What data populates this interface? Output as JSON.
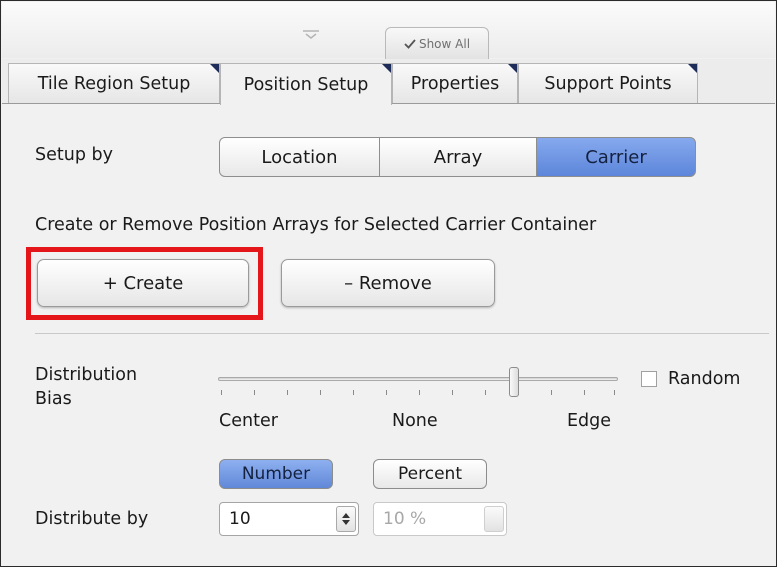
{
  "header": {
    "show_all_label": "Show All"
  },
  "tabs": [
    {
      "label": "Tile Region Setup"
    },
    {
      "label": "Position Setup"
    },
    {
      "label": "Properties"
    },
    {
      "label": "Support Points"
    }
  ],
  "setup_by": {
    "label": "Setup by",
    "options": [
      "Location",
      "Array",
      "Carrier"
    ],
    "selected": "Carrier"
  },
  "arrays": {
    "description": "Create or Remove Position Arrays for Selected Carrier Container",
    "create_label": "+ Create",
    "remove_label": "– Remove"
  },
  "distribution": {
    "label_line1": "Distribution",
    "label_line2": "Bias",
    "slider_labels": [
      "Center",
      "None",
      "Edge"
    ],
    "random_label": "Random",
    "random_checked": false
  },
  "distribute": {
    "label": "Distribute by",
    "mode_options": [
      "Number",
      "Percent"
    ],
    "selected_mode": "Number",
    "number_value": "10",
    "percent_value": "10 %"
  },
  "colors": {
    "accent": "#6b92e0",
    "highlight": "#e4161a"
  }
}
